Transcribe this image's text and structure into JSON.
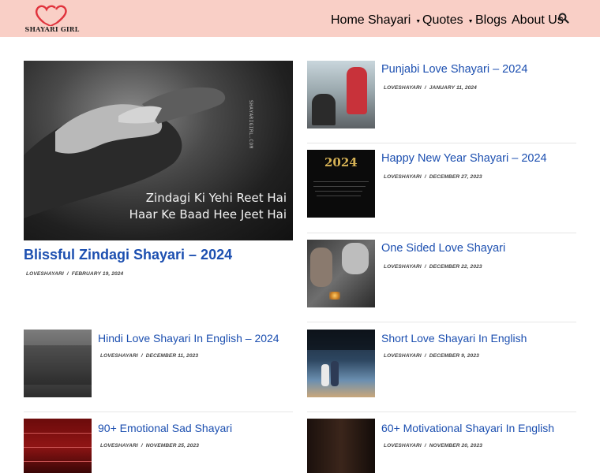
{
  "header": {
    "logo_text": "SHAYARI GIRL",
    "nav": {
      "home": "Home",
      "shayari": "Shayari",
      "quotes": "Quotes",
      "blogs": "Blogs",
      "about": "About Us"
    }
  },
  "featured": {
    "image_line1": "Zindagi Ki Yehi Reet Hai",
    "image_line2": "Haar Ke Baad Hee Jeet Hai",
    "watermark": "SHAYARIGIRL.COM",
    "title": "Blissful Zindagi Shayari – 2024",
    "author": "LOVESHAYARI",
    "date": "FEBRUARY 19, 2024"
  },
  "side_posts": [
    {
      "title": "Punjabi Love Shayari – 2024",
      "author": "LOVESHAYARI",
      "date": "JANUARY 11, 2024"
    },
    {
      "title": "Happy New Year Shayari – 2024",
      "author": "LOVESHAYARI",
      "date": "DECEMBER 27, 2023",
      "thumb_text": "2024"
    },
    {
      "title": "One Sided Love Shayari",
      "author": "LOVESHAYARI",
      "date": "DECEMBER 22, 2023"
    }
  ],
  "grid_posts": [
    {
      "title": "Hindi Love Shayari In English – 2024",
      "author": "LOVESHAYARI",
      "date": "DECEMBER 11, 2023"
    },
    {
      "title": "Short Love Shayari In English",
      "author": "LOVESHAYARI",
      "date": "DECEMBER 9, 2023"
    },
    {
      "title": "90+ Emotional Sad Shayari",
      "author": "LOVESHAYARI",
      "date": "NOVEMBER 25, 2023"
    },
    {
      "title": "60+ Motivational Shayari In English",
      "author": "LOVESHAYARI",
      "date": "NOVEMBER 20, 2023"
    }
  ],
  "colors": {
    "header_bg": "#f9cfc6",
    "title_blue": "#1c4fb0",
    "logo_heart": "#e0323c"
  }
}
